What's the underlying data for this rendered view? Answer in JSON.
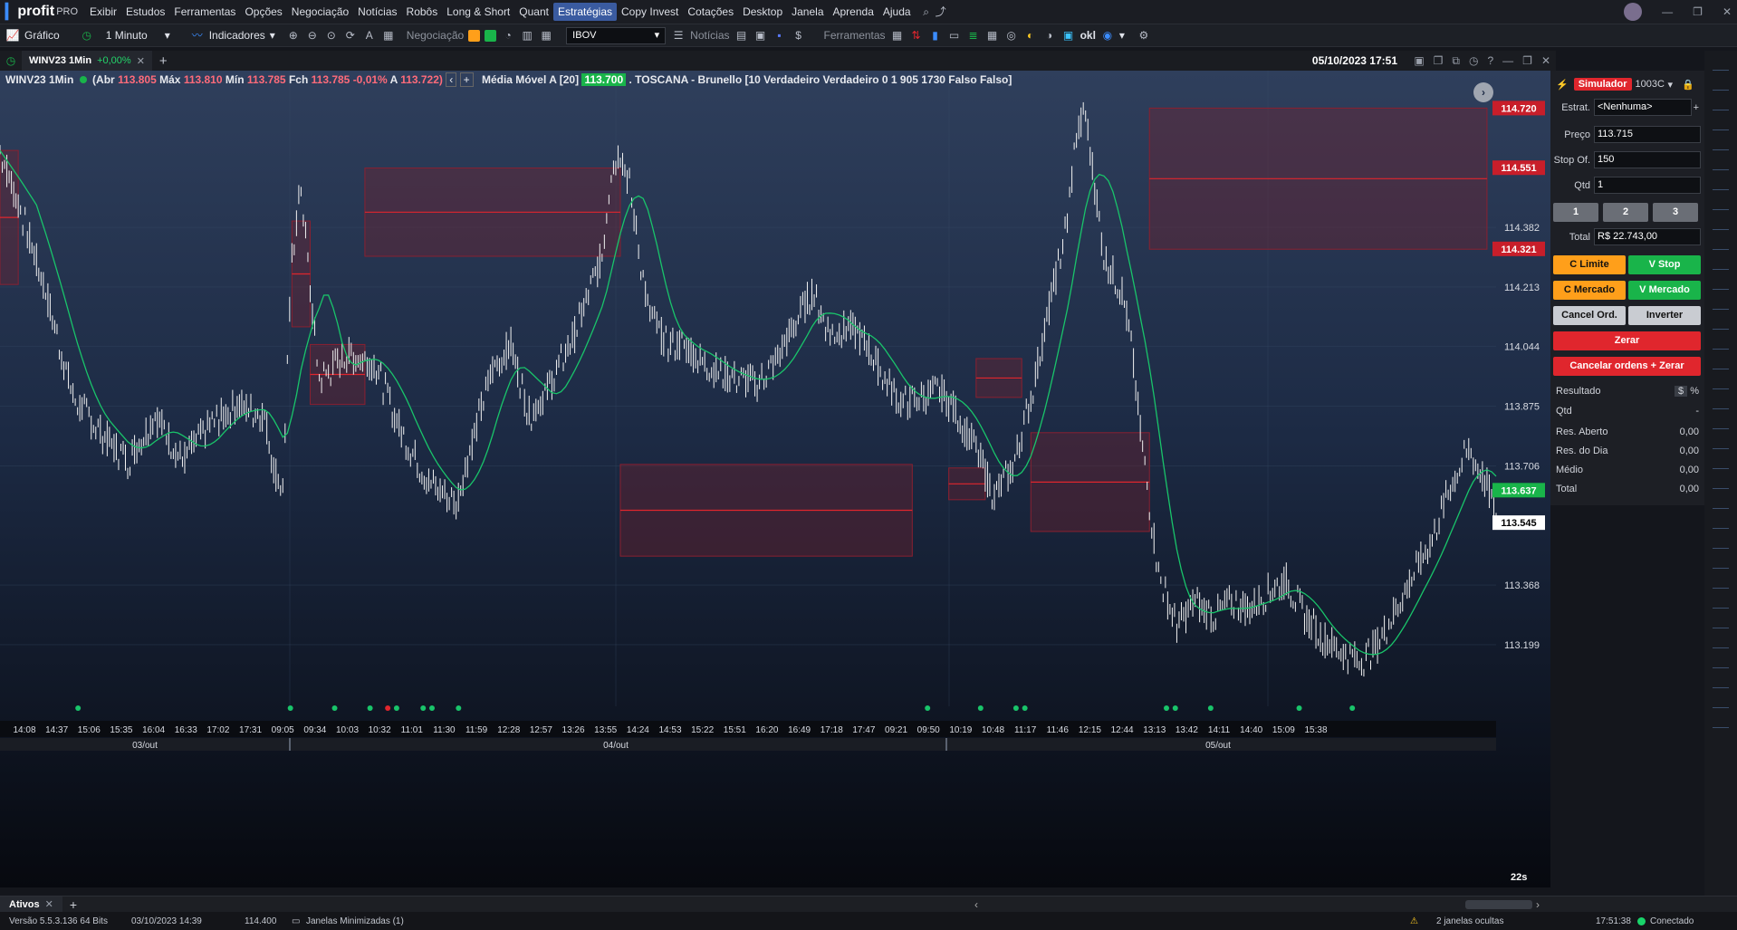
{
  "menu": {
    "app": "profit",
    "edition": "PRO",
    "items": [
      "Exibir",
      "Estudos",
      "Ferramentas",
      "Opções",
      "Negociação",
      "Notícias",
      "Robôs",
      "Long & Short",
      "Quant",
      "Estratégias",
      "Copy Invest",
      "Cotações",
      "Desktop",
      "Janela",
      "Aprenda",
      "Ajuda"
    ],
    "active": "Estratégias"
  },
  "toolbar": {
    "grafico": "Gráfico",
    "interval": "1 Minuto",
    "indicadores": "Indicadores",
    "negociacao": "Negociação",
    "asset": "IBOV",
    "noticias": "Notícias",
    "ferramentas": "Ferramentas",
    "okl": "okl"
  },
  "tab": {
    "name": "WINV23 1Min",
    "change": "+0,00%",
    "datetime": "05/10/2023 17:51"
  },
  "legend": {
    "symbol": "WINV23 1Min",
    "abr_l": "(Abr",
    "abr": "113.805",
    "max_l": "Máx",
    "max": "113.810",
    "min_l": "Mín",
    "min": "113.785",
    "fch_l": "Fch",
    "fch": "113.785 -0,01%",
    "a_l": "A",
    "a": "113.722)",
    "mma_l": "Média Móvel A [20]",
    "mma": "113.700",
    "toscana": ". TOSCANA - Brunello [10 Verdadeiro Verdadeiro 0 1 905 1730 Falso Falso]"
  },
  "chart_data": {
    "type": "candlestick",
    "price_ticks": [
      "114.382",
      "114.213",
      "114.044",
      "113.875",
      "113.706",
      "113.368",
      "113.199"
    ],
    "price_labels": [
      {
        "text": "114.720",
        "kind": "red"
      },
      {
        "text": "114.551",
        "kind": "red"
      },
      {
        "text": "114.321",
        "kind": "red"
      },
      {
        "text": "113.637",
        "kind": "green"
      },
      {
        "text": "113.545",
        "kind": "white"
      }
    ],
    "ylim": [
      113.05,
      114.78
    ],
    "time_ticks": [
      "14:08",
      "14:37",
      "15:06",
      "15:35",
      "16:04",
      "16:33",
      "17:02",
      "17:31",
      "09:05",
      "09:34",
      "10:03",
      "10:32",
      "11:01",
      "11:30",
      "11:59",
      "12:28",
      "12:57",
      "13:26",
      "13:55",
      "14:24",
      "14:53",
      "15:22",
      "15:51",
      "16:20",
      "16:49",
      "17:18",
      "17:47",
      "09:21",
      "09:50",
      "10:19",
      "10:48",
      "11:17",
      "11:46",
      "12:15",
      "12:44",
      "13:13",
      "13:42",
      "14:11",
      "14:40",
      "15:09",
      "15:38"
    ],
    "dates": [
      "03/out",
      "04/out",
      "05/out"
    ],
    "countdown": "22s",
    "path": [
      [
        0,
        114.6
      ],
      [
        2,
        114.45
      ],
      [
        5,
        114.2
      ],
      [
        8,
        113.9
      ],
      [
        11,
        113.8
      ],
      [
        14,
        113.72
      ],
      [
        17,
        113.85
      ],
      [
        20,
        113.72
      ],
      [
        23,
        113.82
      ],
      [
        26,
        113.88
      ],
      [
        29,
        113.85
      ],
      [
        30,
        113.7
      ],
      [
        31,
        113.64
      ],
      [
        32,
        114.3
      ],
      [
        33,
        114.5
      ],
      [
        34,
        114.2
      ],
      [
        35,
        113.95
      ],
      [
        38,
        114.02
      ],
      [
        41,
        114.0
      ],
      [
        44,
        113.8
      ],
      [
        47,
        113.66
      ],
      [
        50,
        113.6
      ],
      [
        52,
        113.8
      ],
      [
        54,
        113.98
      ],
      [
        56,
        114.05
      ],
      [
        58,
        113.85
      ],
      [
        60,
        113.92
      ],
      [
        63,
        114.08
      ],
      [
        66,
        114.3
      ],
      [
        67,
        114.55
      ],
      [
        68,
        114.6
      ],
      [
        69,
        114.5
      ],
      [
        71,
        114.15
      ],
      [
        73,
        114.05
      ],
      [
        75,
        114.05
      ],
      [
        77,
        114.0
      ],
      [
        79,
        113.97
      ],
      [
        81,
        113.95
      ],
      [
        83,
        113.94
      ],
      [
        85,
        114.0
      ],
      [
        87,
        114.1
      ],
      [
        89,
        114.2
      ],
      [
        91,
        114.08
      ],
      [
        93,
        114.1
      ],
      [
        95,
        114.05
      ],
      [
        97,
        113.95
      ],
      [
        99,
        113.88
      ],
      [
        101,
        113.9
      ],
      [
        103,
        113.92
      ],
      [
        105,
        113.85
      ],
      [
        107,
        113.75
      ],
      [
        109,
        113.62
      ],
      [
        111,
        113.7
      ],
      [
        113,
        113.9
      ],
      [
        115,
        114.15
      ],
      [
        117,
        114.4
      ],
      [
        118,
        114.65
      ],
      [
        119,
        114.7
      ],
      [
        120,
        114.5
      ],
      [
        121,
        114.3
      ],
      [
        123,
        114.2
      ],
      [
        124,
        114.05
      ],
      [
        125,
        113.8
      ],
      [
        126,
        113.6
      ],
      [
        127,
        113.4
      ],
      [
        129,
        113.25
      ],
      [
        131,
        113.32
      ],
      [
        133,
        113.28
      ],
      [
        135,
        113.32
      ],
      [
        137,
        113.3
      ],
      [
        139,
        113.35
      ],
      [
        141,
        113.38
      ],
      [
        143,
        113.28
      ],
      [
        145,
        113.22
      ],
      [
        147,
        113.18
      ],
      [
        149,
        113.15
      ],
      [
        151,
        113.2
      ],
      [
        153,
        113.3
      ],
      [
        155,
        113.4
      ],
      [
        157,
        113.5
      ],
      [
        159,
        113.65
      ],
      [
        161,
        113.75
      ],
      [
        163,
        113.65
      ],
      [
        164,
        113.56
      ]
    ],
    "boxes": [
      [
        0,
        114.6,
        2,
        114.22
      ],
      [
        32,
        114.4,
        34,
        114.1
      ],
      [
        34,
        114.05,
        40,
        113.88
      ],
      [
        40,
        114.55,
        68,
        114.3
      ],
      [
        68,
        113.71,
        100,
        113.45
      ],
      [
        104,
        113.7,
        108,
        113.61
      ],
      [
        107,
        114.01,
        112,
        113.9
      ],
      [
        113,
        113.8,
        126,
        113.52
      ],
      [
        126,
        114.72,
        163,
        114.32
      ]
    ]
  },
  "sidebar": {
    "mode": "Simulador",
    "account": "1003C",
    "estrat_l": "Estrat.",
    "estrat": "<Nenhuma>",
    "preco_l": "Preço",
    "preco": "113.715",
    "stop_l": "Stop Of.",
    "stop": "150",
    "qtd_l": "Qtd",
    "qtd": "1",
    "q1": "1",
    "q2": "2",
    "q3": "3",
    "total_l": "Total",
    "total": "R$ 22.743,00",
    "climite": "C Limite",
    "vstop": "V Stop",
    "cmercado": "C Mercado",
    "vmercado": "V Mercado",
    "cancel": "Cancel Ord.",
    "inverter": "Inverter",
    "zerar": "Zerar",
    "cancelzerar": "Cancelar ordens + Zerar",
    "resultado": "Resultado",
    "cur": "$",
    "pct": "%",
    "rows": [
      {
        "l": "Qtd",
        "v": "-"
      },
      {
        "l": "Res. Aberto",
        "v": "0,00"
      },
      {
        "l": "Res. do Dia",
        "v": "0,00"
      },
      {
        "l": "Médio",
        "v": "0,00"
      },
      {
        "l": "Total",
        "v": "0,00"
      }
    ]
  },
  "bottom": {
    "tab": "Ativos"
  },
  "status": {
    "version": "Versão 5.5.3.136 64 Bits",
    "date": "03/10/2023 14:39",
    "price": "114.400",
    "janelas": "Janelas Minimizadas (1)",
    "ocultas": "2 janelas ocultas",
    "time": "17:51:38",
    "conn": "Conectado"
  },
  "colors": {
    "accent": "#3a5ba0",
    "buy": "#ff9f1a",
    "sell": "#19b44a",
    "danger": "#e0262d"
  }
}
